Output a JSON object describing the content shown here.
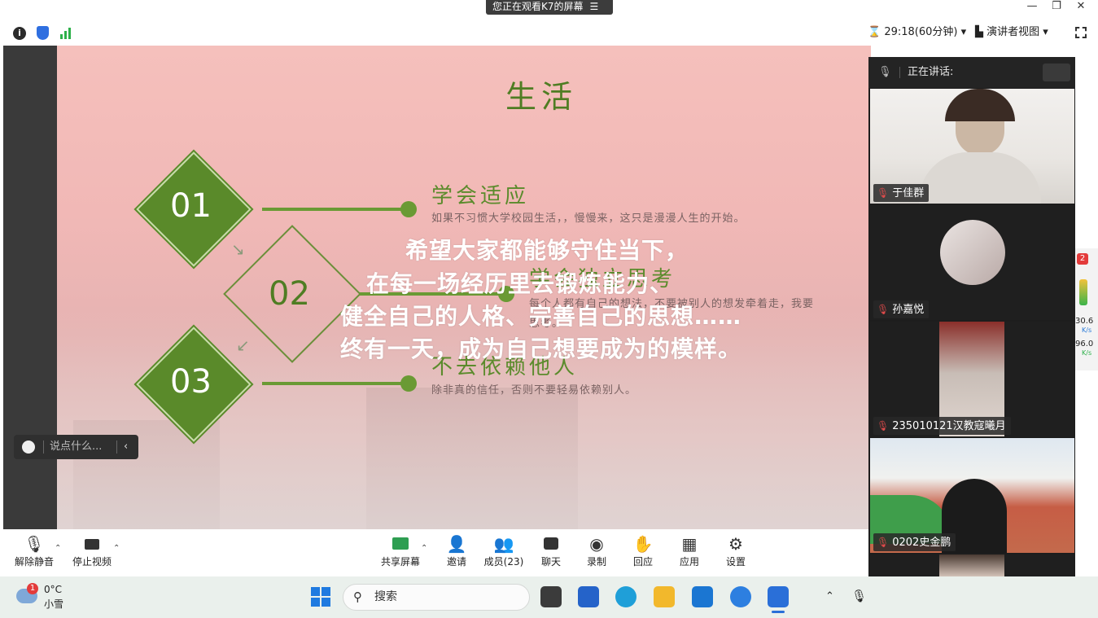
{
  "window": {
    "banner": "您正在观看K7的屏幕",
    "banner_icon": "menu-icon",
    "minimize": "—",
    "restore": "❐",
    "close": "✕"
  },
  "meeting_bar": {
    "timer": "29:18(60分钟)",
    "view_mode": "演讲者视图",
    "caret": "▾"
  },
  "slide": {
    "title": "生活",
    "items": [
      {
        "number": "01",
        "heading": "学会适应",
        "desc": "如果不习惯大学校园生活，，慢慢来，这只是漫漫人生的开始。"
      },
      {
        "number": "02",
        "heading": "学会独立思考",
        "desc": "每个人都有自己的想法，不要被别人的想发牵着走，我要",
        "desc2": "思考。"
      },
      {
        "number": "03",
        "heading": "不去依赖他人",
        "desc": "除非真的信任，否则不要轻易依赖别人。"
      }
    ],
    "overlay": [
      "希望大家都能够守住当下，",
      "在每一场经历里去锻炼能力、",
      "健全自己的人格、完善自己的思想……",
      "终有一天，成为自己想要成为的模样。"
    ],
    "accent": "#5a8a2a"
  },
  "chat": {
    "placeholder": "说点什么...",
    "collapse": "‹"
  },
  "panel": {
    "speaking_label": "正在讲话:",
    "participants": [
      {
        "name": "于佳群"
      },
      {
        "name": "孙嘉悦"
      },
      {
        "name": "235010121汉教寇曦月"
      },
      {
        "name": "0202史金鹏"
      }
    ]
  },
  "edge": {
    "badge": "2",
    "rate1": "30.6",
    "unit1": "K/s",
    "rate2": "96.0",
    "unit2": "K/s"
  },
  "controls": {
    "unmute": "解除静音",
    "stop_video": "停止视频",
    "share": "共享屏幕",
    "invite": "邀请",
    "members": "成员(23)",
    "chat": "聊天",
    "record": "录制",
    "react": "回应",
    "apps": "应用",
    "settings": "设置"
  },
  "taskbar": {
    "weather_badge": "1",
    "temp": "0°C",
    "weather": "小雪",
    "search": "搜索"
  }
}
